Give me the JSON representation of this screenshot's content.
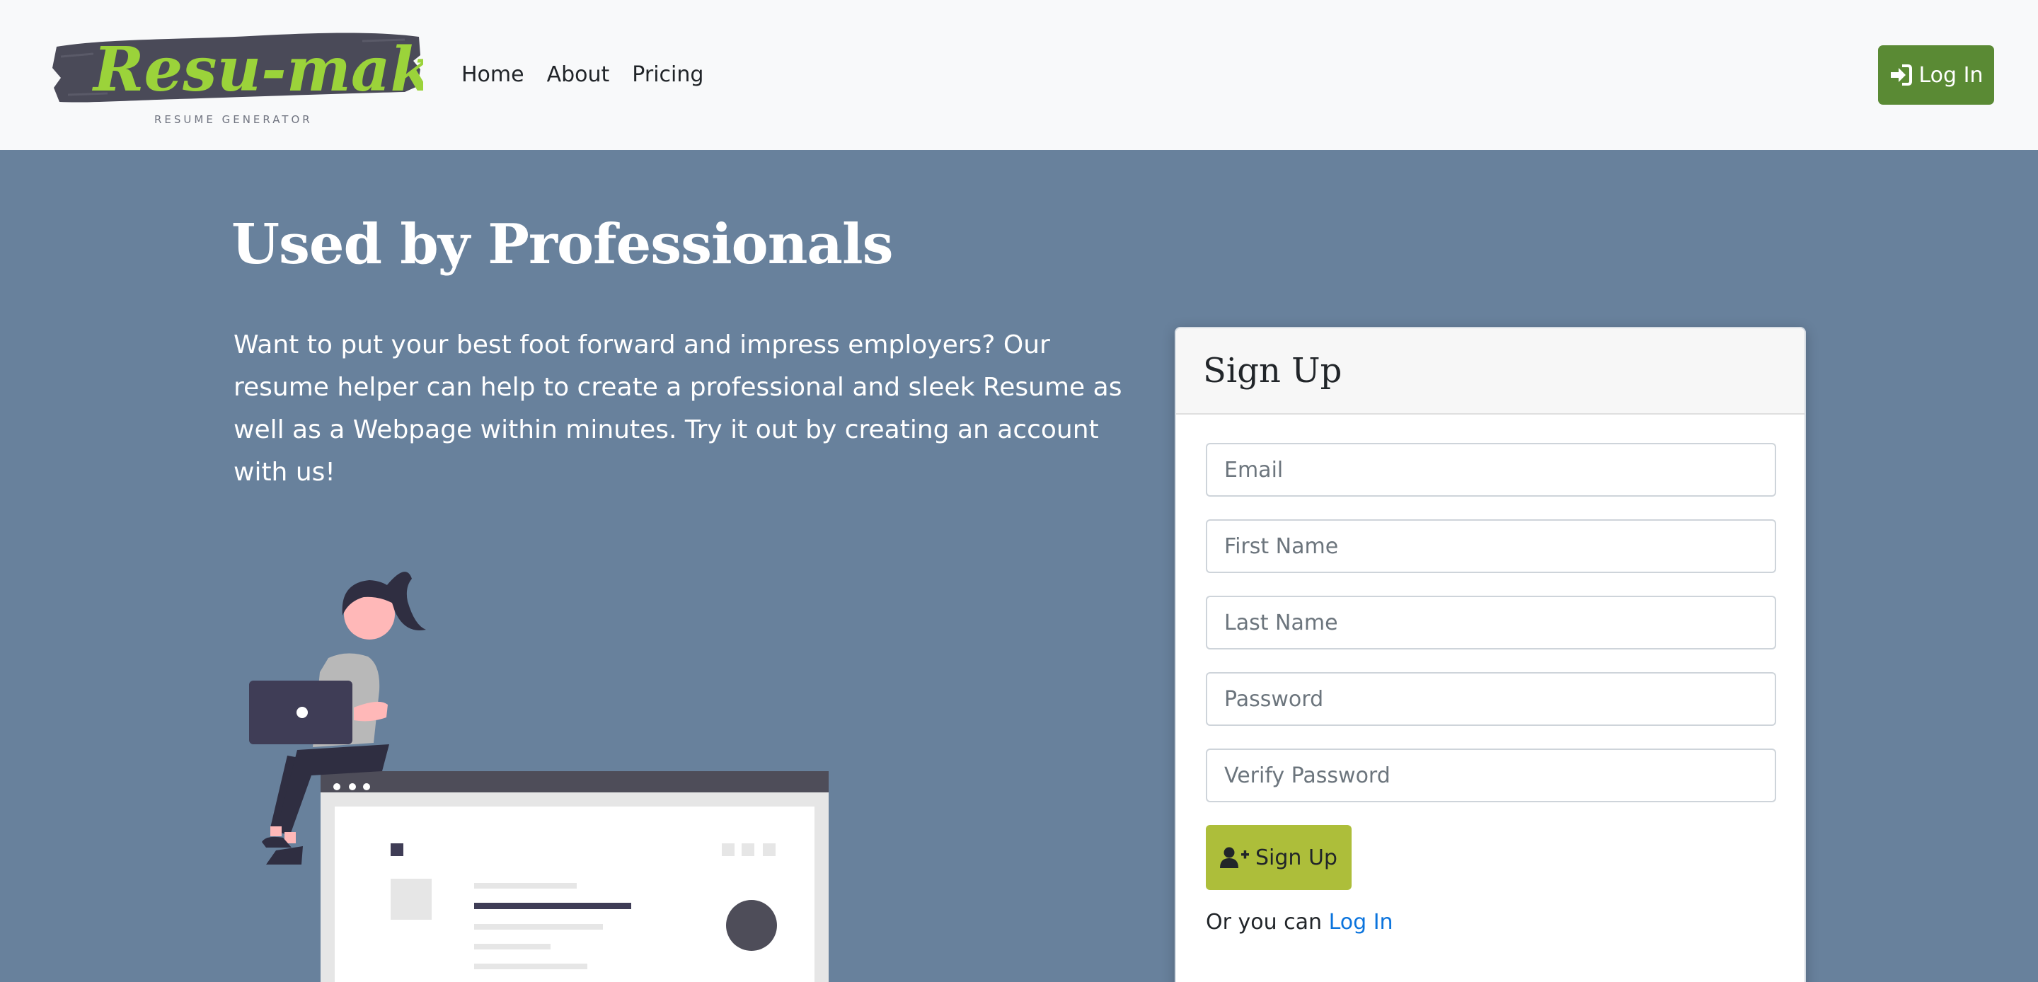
{
  "brand": {
    "logo_text": "Resu-make",
    "tagline": "RESUME GENERATOR"
  },
  "nav": {
    "links": [
      "Home",
      "About",
      "Pricing"
    ],
    "login_label": "Log In",
    "login_icon": "sign-in-icon"
  },
  "hero": {
    "title": "Used by Professionals",
    "description": "Want to put your best foot forward and impress employers? Our resume helper can help to create a professional and sleek Resume as well as a Webpage within minutes. Try it out by creating an account with us!"
  },
  "signup": {
    "title": "Sign Up",
    "fields": {
      "email": {
        "placeholder": "Email",
        "value": ""
      },
      "first_name": {
        "placeholder": "First Name",
        "value": ""
      },
      "last_name": {
        "placeholder": "Last Name",
        "value": ""
      },
      "password": {
        "placeholder": "Password",
        "value": ""
      },
      "verify_password": {
        "placeholder": "Verify Password",
        "value": ""
      }
    },
    "submit_label": "Sign Up",
    "submit_icon": "user-plus-icon",
    "alt_prefix": "Or you can",
    "alt_link": "Log In"
  },
  "colors": {
    "navbar_bg": "#f8f9fa",
    "page_bg": "#68819c",
    "login_button": "#5a8a34",
    "signup_button": "#adbe3a",
    "link": "#0b74dd",
    "logo_green": "#9bd33a",
    "logo_brush": "#4a4a58"
  }
}
